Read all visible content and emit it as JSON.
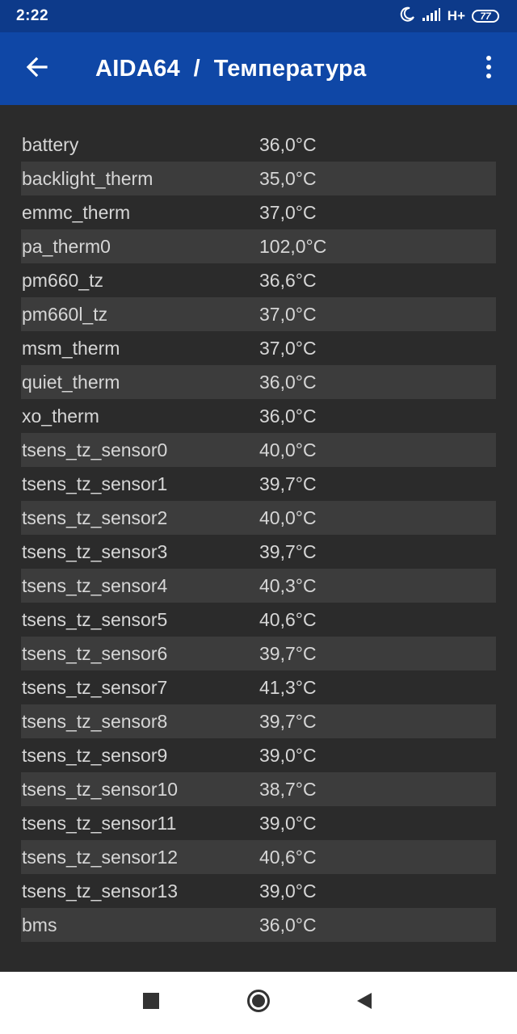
{
  "status_bar": {
    "time": "2:22",
    "network": "H+",
    "battery": "77",
    "icons": [
      "moon-icon",
      "signal-icon",
      "battery-icon"
    ]
  },
  "app_bar": {
    "title": "AIDA64  /  Температура",
    "back_icon": "arrow-left-icon",
    "menu_icon": "more-vert-icon"
  },
  "sensors": [
    {
      "name": "battery",
      "value": "36,0°C"
    },
    {
      "name": "backlight_therm",
      "value": "35,0°C"
    },
    {
      "name": "emmc_therm",
      "value": "37,0°C"
    },
    {
      "name": "pa_therm0",
      "value": "102,0°C"
    },
    {
      "name": "pm660_tz",
      "value": "36,6°C"
    },
    {
      "name": "pm660l_tz",
      "value": "37,0°C"
    },
    {
      "name": "msm_therm",
      "value": "37,0°C"
    },
    {
      "name": "quiet_therm",
      "value": "36,0°C"
    },
    {
      "name": "xo_therm",
      "value": "36,0°C"
    },
    {
      "name": "tsens_tz_sensor0",
      "value": "40,0°C"
    },
    {
      "name": "tsens_tz_sensor1",
      "value": "39,7°C"
    },
    {
      "name": "tsens_tz_sensor2",
      "value": "40,0°C"
    },
    {
      "name": "tsens_tz_sensor3",
      "value": "39,7°C"
    },
    {
      "name": "tsens_tz_sensor4",
      "value": "40,3°C"
    },
    {
      "name": "tsens_tz_sensor5",
      "value": "40,6°C"
    },
    {
      "name": "tsens_tz_sensor6",
      "value": "39,7°C"
    },
    {
      "name": "tsens_tz_sensor7",
      "value": "41,3°C"
    },
    {
      "name": "tsens_tz_sensor8",
      "value": "39,7°C"
    },
    {
      "name": "tsens_tz_sensor9",
      "value": "39,0°C"
    },
    {
      "name": "tsens_tz_sensor10",
      "value": "38,7°C"
    },
    {
      "name": "tsens_tz_sensor11",
      "value": "39,0°C"
    },
    {
      "name": "tsens_tz_sensor12",
      "value": "40,6°C"
    },
    {
      "name": "tsens_tz_sensor13",
      "value": "39,0°C"
    },
    {
      "name": "bms",
      "value": "36,0°C"
    }
  ],
  "nav_bar": {
    "recents_icon": "square-icon",
    "home_icon": "circle-icon",
    "back_icon": "triangle-back-icon"
  },
  "colors": {
    "status_bar_bg": "#0d3a8a",
    "app_bar_bg": "#0f47a6",
    "content_bg": "#2b2b2b",
    "alt_row_bg": "#3c3c3c",
    "text": "#d6d6d6"
  }
}
